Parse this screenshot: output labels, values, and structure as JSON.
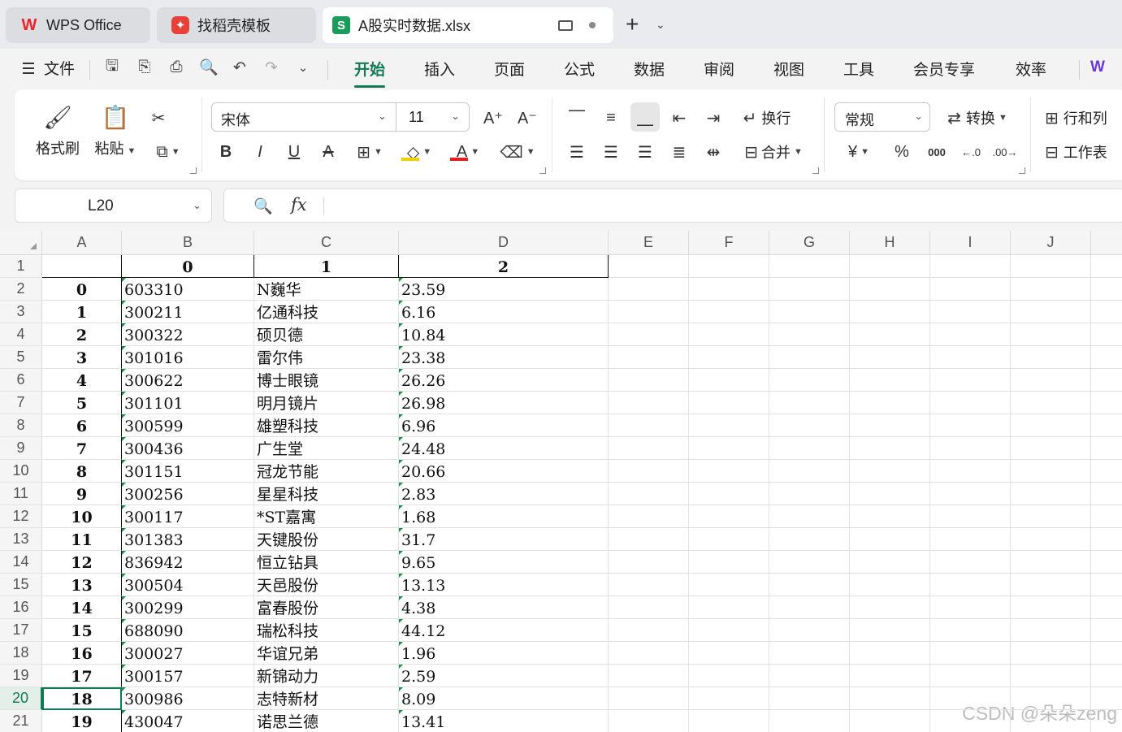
{
  "tabs": [
    {
      "label": "WPS Office",
      "icon": "wps-logo-icon"
    },
    {
      "label": "找稻壳模板",
      "icon": "docer-icon"
    },
    {
      "label": "A股实时数据.xlsx",
      "icon": "spreadsheet-icon",
      "icon_letter": "S"
    }
  ],
  "menu": {
    "file_label": "文件",
    "tabs": [
      "开始",
      "插入",
      "页面",
      "公式",
      "数据",
      "审阅",
      "视图",
      "工具",
      "会员专享",
      "效率"
    ],
    "active_tab": "开始",
    "partial_tab": "W"
  },
  "ribbon": {
    "format_painter": "格式刷",
    "paste": "粘贴",
    "font_name": "宋体",
    "font_size": "11",
    "wrap_text": "换行",
    "merge": "合并",
    "number_format": "常规",
    "convert": "转换",
    "rows_cols": "行和列",
    "worksheet": "工作表",
    "percent": "%",
    "thousands": "000",
    "font_color_hex": "#e02020",
    "fill_color_hex": "#f0d000",
    "accent_hex": "#127a55"
  },
  "formula_bar": {
    "cell_ref": "L20",
    "fx": "fx",
    "value": ""
  },
  "sheet": {
    "columns": [
      "A",
      "B",
      "C",
      "D",
      "E",
      "F",
      "G",
      "H",
      "I",
      "J"
    ],
    "row_numbers": [
      "1",
      "2",
      "3",
      "4",
      "5",
      "6",
      "7",
      "8",
      "9",
      "10",
      "11",
      "12",
      "13",
      "14",
      "15",
      "16",
      "17",
      "18",
      "19",
      "20",
      "21"
    ],
    "selected_row": "20",
    "header_row": [
      "",
      "0",
      "1",
      "2"
    ],
    "rows": [
      [
        "0",
        "603310",
        "N巍华",
        "23.59"
      ],
      [
        "1",
        "300211",
        "亿通科技",
        "6.16"
      ],
      [
        "2",
        "300322",
        "硕贝德",
        "10.84"
      ],
      [
        "3",
        "301016",
        "雷尔伟",
        "23.38"
      ],
      [
        "4",
        "300622",
        "博士眼镜",
        "26.26"
      ],
      [
        "5",
        "301101",
        "明月镜片",
        "26.98"
      ],
      [
        "6",
        "300599",
        "雄塑科技",
        "6.96"
      ],
      [
        "7",
        "300436",
        "广生堂",
        "24.48"
      ],
      [
        "8",
        "301151",
        "冠龙节能",
        "20.66"
      ],
      [
        "9",
        "300256",
        "星星科技",
        "2.83"
      ],
      [
        "10",
        "300117",
        "*ST嘉寓",
        "1.68"
      ],
      [
        "11",
        "301383",
        "天键股份",
        "31.7"
      ],
      [
        "12",
        "836942",
        "恒立钻具",
        "9.65"
      ],
      [
        "13",
        "300504",
        "天邑股份",
        "13.13"
      ],
      [
        "14",
        "300299",
        "富春股份",
        "4.38"
      ],
      [
        "15",
        "688090",
        "瑞松科技",
        "44.12"
      ],
      [
        "16",
        "300027",
        "华谊兄弟",
        "1.96"
      ],
      [
        "17",
        "300157",
        "新锦动力",
        "2.59"
      ],
      [
        "18",
        "300986",
        "志特新材",
        "8.09"
      ],
      [
        "19",
        "430047",
        "诺思兰德",
        "13.41"
      ]
    ]
  },
  "watermark": "CSDN @朵朵zeng"
}
